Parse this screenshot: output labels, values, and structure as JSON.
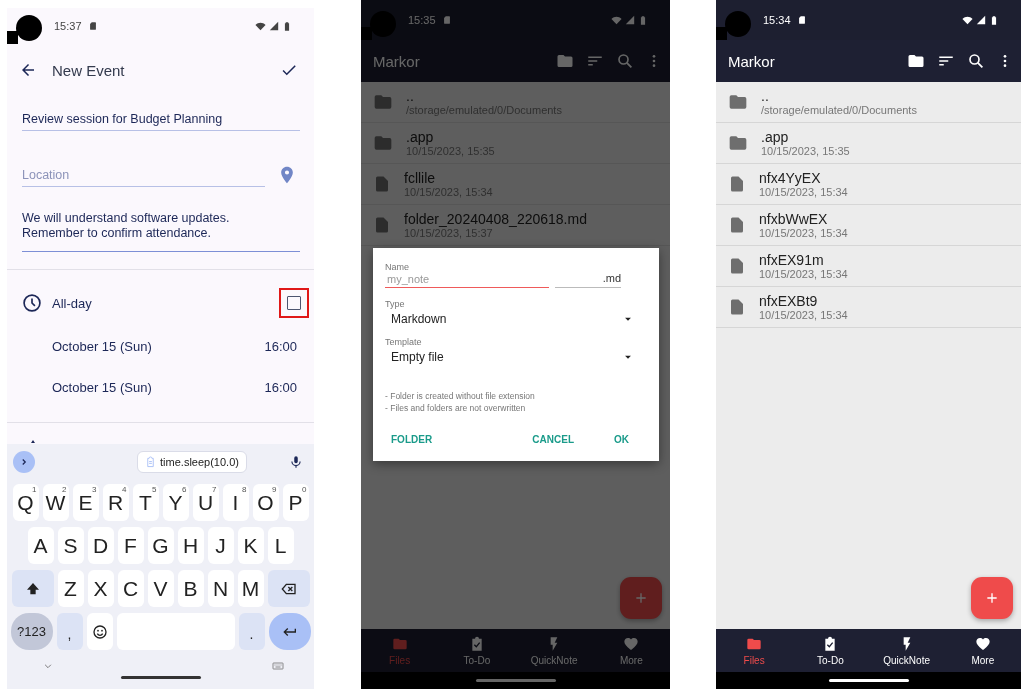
{
  "event_screen": {
    "status_bar": {
      "time": "15:37"
    },
    "header": {
      "title": "New Event"
    },
    "title_field": {
      "value": "Review session for Budget Planning"
    },
    "location_field": {
      "placeholder": "Location"
    },
    "description_field": {
      "value": "We will understand software updates.\nRemember to confirm attendance."
    },
    "all_day": {
      "label": "All-day",
      "checked": false,
      "highlighted": true
    },
    "times": [
      {
        "date": "October 15 (Sun)",
        "time": "16:00"
      },
      {
        "date": "October 15 (Sun)",
        "time": "16:00"
      }
    ],
    "keyboard": {
      "suggestion": "time.sleep(10.0)",
      "key_rows": [
        {
          "keys": [
            {
              "kind": "letter",
              "label": "Q",
              "hint": "1"
            },
            {
              "kind": "letter",
              "label": "W",
              "hint": "2"
            },
            {
              "kind": "letter",
              "label": "E",
              "hint": "3"
            },
            {
              "kind": "letter",
              "label": "R",
              "hint": "4"
            },
            {
              "kind": "letter",
              "label": "T",
              "hint": "5"
            },
            {
              "kind": "letter",
              "label": "Y",
              "hint": "6"
            },
            {
              "kind": "letter",
              "label": "U",
              "hint": "7"
            },
            {
              "kind": "letter",
              "label": "I",
              "hint": "8"
            },
            {
              "kind": "letter",
              "label": "O",
              "hint": "9"
            },
            {
              "kind": "letter",
              "label": "P",
              "hint": "0"
            }
          ]
        },
        {
          "keys": [
            {
              "kind": "letter",
              "label": "A"
            },
            {
              "kind": "letter",
              "label": "S"
            },
            {
              "kind": "letter",
              "label": "D"
            },
            {
              "kind": "letter",
              "label": "F"
            },
            {
              "kind": "letter",
              "label": "G"
            },
            {
              "kind": "letter",
              "label": "H"
            },
            {
              "kind": "letter",
              "label": "J"
            },
            {
              "kind": "letter",
              "label": "K"
            },
            {
              "kind": "letter",
              "label": "L"
            }
          ]
        },
        {
          "keys": [
            {
              "kind": "shift"
            },
            {
              "kind": "letter",
              "label": "Z"
            },
            {
              "kind": "letter",
              "label": "X"
            },
            {
              "kind": "letter",
              "label": "C"
            },
            {
              "kind": "letter",
              "label": "V"
            },
            {
              "kind": "letter",
              "label": "B"
            },
            {
              "kind": "letter",
              "label": "N"
            },
            {
              "kind": "letter",
              "label": "M"
            },
            {
              "kind": "backspace"
            }
          ]
        },
        {
          "keys": [
            {
              "kind": "symbols",
              "label": "?123"
            },
            {
              "kind": "punct",
              "label": ","
            },
            {
              "kind": "emoji"
            },
            {
              "kind": "space"
            },
            {
              "kind": "punct",
              "label": "."
            },
            {
              "kind": "enter"
            }
          ]
        }
      ]
    }
  },
  "file_screens": [
    {
      "status_bar": {
        "time": "15:35"
      },
      "toolbar": {
        "title": "Markor"
      },
      "dimmed": true,
      "files": [
        {
          "kind": "folder",
          "name": "..",
          "detail": "/storage/emulated/0/Documents"
        },
        {
          "kind": "folder",
          "name": ".app",
          "detail": "10/15/2023, 15:35"
        },
        {
          "kind": "file",
          "name": "fcllile",
          "detail": "10/15/2023, 15:34"
        },
        {
          "kind": "file",
          "name": "folder_20240408_220618.md",
          "detail": "10/15/2023, 15:37"
        }
      ],
      "dialog": {
        "name_label": "Name",
        "name_placeholder": "my_note",
        "extension": ".md",
        "type_label": "Type",
        "type_value": "Markdown",
        "template_label": "Template",
        "template_value": "Empty file",
        "notes": [
          "- Folder is created without file extension",
          "- Files and folders are not overwritten"
        ],
        "buttons": [
          {
            "label": "FOLDER",
            "kind": "left"
          },
          {
            "label": "CANCEL",
            "kind": "right"
          },
          {
            "label": "OK",
            "kind": "right"
          }
        ]
      },
      "nav": [
        {
          "kind": "files",
          "label": "Files",
          "selected": true
        },
        {
          "kind": "todo",
          "label": "To-Do",
          "selected": false
        },
        {
          "kind": "quicknote",
          "label": "QuickNote",
          "selected": false
        },
        {
          "kind": "more",
          "label": "More",
          "selected": false
        }
      ]
    },
    {
      "status_bar": {
        "time": "15:34"
      },
      "toolbar": {
        "title": "Markor"
      },
      "dimmed": false,
      "files": [
        {
          "kind": "folder",
          "name": "..",
          "detail": "/storage/emulated/0/Documents"
        },
        {
          "kind": "folder",
          "name": ".app",
          "detail": "10/15/2023, 15:35"
        },
        {
          "kind": "file",
          "name": "nfx4YyEX",
          "detail": "10/15/2023, 15:34"
        },
        {
          "kind": "file",
          "name": "nfxbWwEX",
          "detail": "10/15/2023, 15:34"
        },
        {
          "kind": "file",
          "name": "nfxEX91m",
          "detail": "10/15/2023, 15:34"
        },
        {
          "kind": "file",
          "name": "nfxEXBt9",
          "detail": "10/15/2023, 15:34"
        }
      ],
      "nav": [
        {
          "kind": "files",
          "label": "Files",
          "selected": true
        },
        {
          "kind": "todo",
          "label": "To-Do",
          "selected": false
        },
        {
          "kind": "quicknote",
          "label": "QuickNote",
          "selected": false
        },
        {
          "kind": "more",
          "label": "More",
          "selected": false
        }
      ]
    }
  ]
}
